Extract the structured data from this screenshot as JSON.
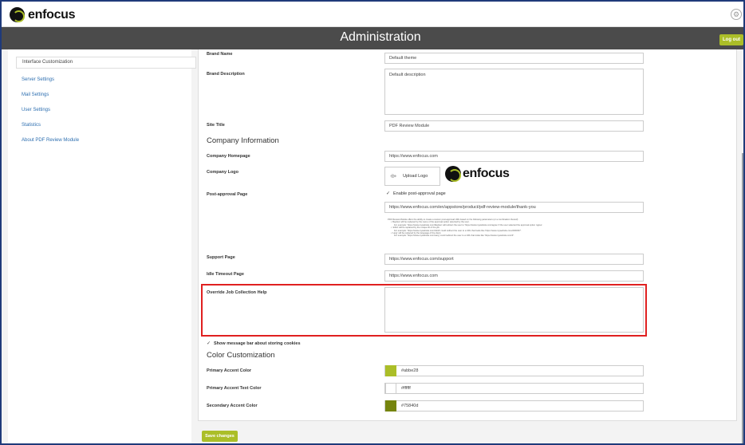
{
  "header": {
    "brand": "enfocus",
    "title": "Administration",
    "logout_label": "Log out"
  },
  "sidebar": {
    "items": [
      {
        "label": "Interface Customization",
        "active": true
      },
      {
        "label": "Server Settings"
      },
      {
        "label": "Mail Settings"
      },
      {
        "label": "User Settings"
      },
      {
        "label": "Statistics"
      },
      {
        "label": "About PDF Review Module"
      }
    ]
  },
  "form": {
    "brand_name_label": "Brand Name",
    "brand_name_value": "Default theme",
    "brand_description_label": "Brand Description",
    "brand_description_value": "Default description",
    "site_title_label": "Site Title",
    "site_title_value": "PDF Review Module",
    "company_section": "Company Information",
    "company_homepage_label": "Company Homepage",
    "company_homepage_value": "https://www.enfocus.com",
    "company_logo_label": "Company Logo",
    "upload_logo_label": "Upload Logo",
    "logo_preview_text": "enfocus",
    "post_approval_label": "Post-approval Page",
    "enable_post_approval_label": "Enable post-approval page",
    "enable_post_approval_checked": true,
    "post_approval_value": "https://www.enfocus.com/en/appstore/product/pdf-review-module/thank-you",
    "help_lines": [
      "PDF Review Module offers the ability to create a custom post-approval URL based on the following parameters (or a combination thereof):",
      "• 'Replies' will be replaced by the name of the approval option selected by the user.",
      "For example: 'https://www.mywebsite.com/Replies' will redirect the user to 'https://www.mywebsite.com/agree' if the user selected the approval option 'agree'.",
      "• 'JobId' will be replaced by the unique ID of the job.",
      "For example: 'https://www.mywebsite.com/JobId' could redirect the user to a URL that looks like 'https://www.mywebsite.com/ADD007'.",
      "• 'Lang' will be replaced by the language of the client.",
      "For example: 'https://www.mywebsite.com/Lang' could redirect the user to a URL that looks like 'https://www.mywebsite.com/fr'."
    ],
    "support_page_label": "Support Page",
    "support_page_value": "https://www.enfocus.com/support",
    "idle_timeout_label": "Idle Timeout Page",
    "idle_timeout_value": "https://www.enfocus.com",
    "override_help_label": "Override Job Collection Help",
    "override_help_value": "",
    "cookies_label": "Show message bar about storing cookies",
    "cookies_checked": true,
    "color_section": "Color Customization",
    "primary_accent_label": "Primary Accent Color",
    "primary_accent_value": "#abbe28",
    "primary_text_label": "Primary Accent Text Color",
    "primary_text_value": "#ffffff",
    "secondary_accent_label": "Secondary Accent Color",
    "secondary_accent_value": "#75840d",
    "save_label": "Save changes"
  },
  "colors": {
    "accent": "#abbe28",
    "header_bg": "#4b4b4b",
    "secondary": "#75840d",
    "highlight": "#e02020"
  },
  "icons": {
    "settings": "gear-icon",
    "upload": "upload-icon",
    "check": "checkmark-icon"
  }
}
